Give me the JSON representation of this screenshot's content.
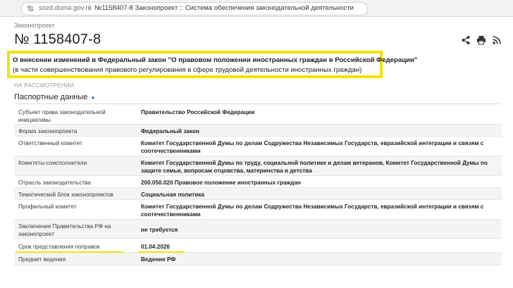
{
  "browser": {
    "url": "sozd.duma.gov.ru",
    "separator": "|",
    "page_title": "№1158407-8 Законопроект :: Система обеспечения законодательной деятельности"
  },
  "header": {
    "type_label": "Законопроект",
    "bill_number": "№ 1158407-8",
    "actions": [
      "share-icon",
      "print-icon",
      "rss-icon"
    ]
  },
  "bill": {
    "title_line1": "О внесении изменений в Федеральный закон \"О правовом положении иностранных граждан в Российской Федерации\"",
    "title_line2": "(в части совершенствования правового регулирования в сфере трудовой деятельности иностранных граждан)",
    "status": "НА РАССМОТРЕНИИ"
  },
  "passport": {
    "section_title": "Паспортные данные",
    "toggle_glyph": "▲",
    "rows": [
      {
        "key": "Субъект права законодательной инициативы",
        "value": "Правительство Российской Федерации"
      },
      {
        "key": "Форма законопроекта",
        "value": "Федеральный закон"
      },
      {
        "key": "Ответственный комитет",
        "value": "Комитет Государственной Думы по делам Содружества Независимых Государств, евразийской интеграции и связям с соотечественниками"
      },
      {
        "key": "Комитеты-соисполнители",
        "value": "Комитет Государственной Думы по труду, социальной политике и делам ветеранов, Комитет Государственной Думы по защите семьи, вопросам отцовства, материнства и детства"
      },
      {
        "key": "Отрасль законодательства",
        "value": "200.050.020 Правовое положение иностранных граждан"
      },
      {
        "key": "Тематический блок законопроектов",
        "value": "Социальная политика"
      },
      {
        "key": "Профильный комитет",
        "value": "Комитет Государственной Думы по делам Содружества Независимых Государств, евразийской интеграции и связям с соотечественниками"
      },
      {
        "key": "Заключение Правительства РФ на законопроект",
        "value": "не требуется"
      },
      {
        "key": "Срок представления поправок",
        "value": "01.04.2026"
      },
      {
        "key": "Предмет ведения",
        "value": "Ведение РФ"
      }
    ]
  },
  "colors": {
    "highlight": "#f2e20a",
    "accent": "#2a67b1",
    "row_alt": "#f4f4f4"
  }
}
